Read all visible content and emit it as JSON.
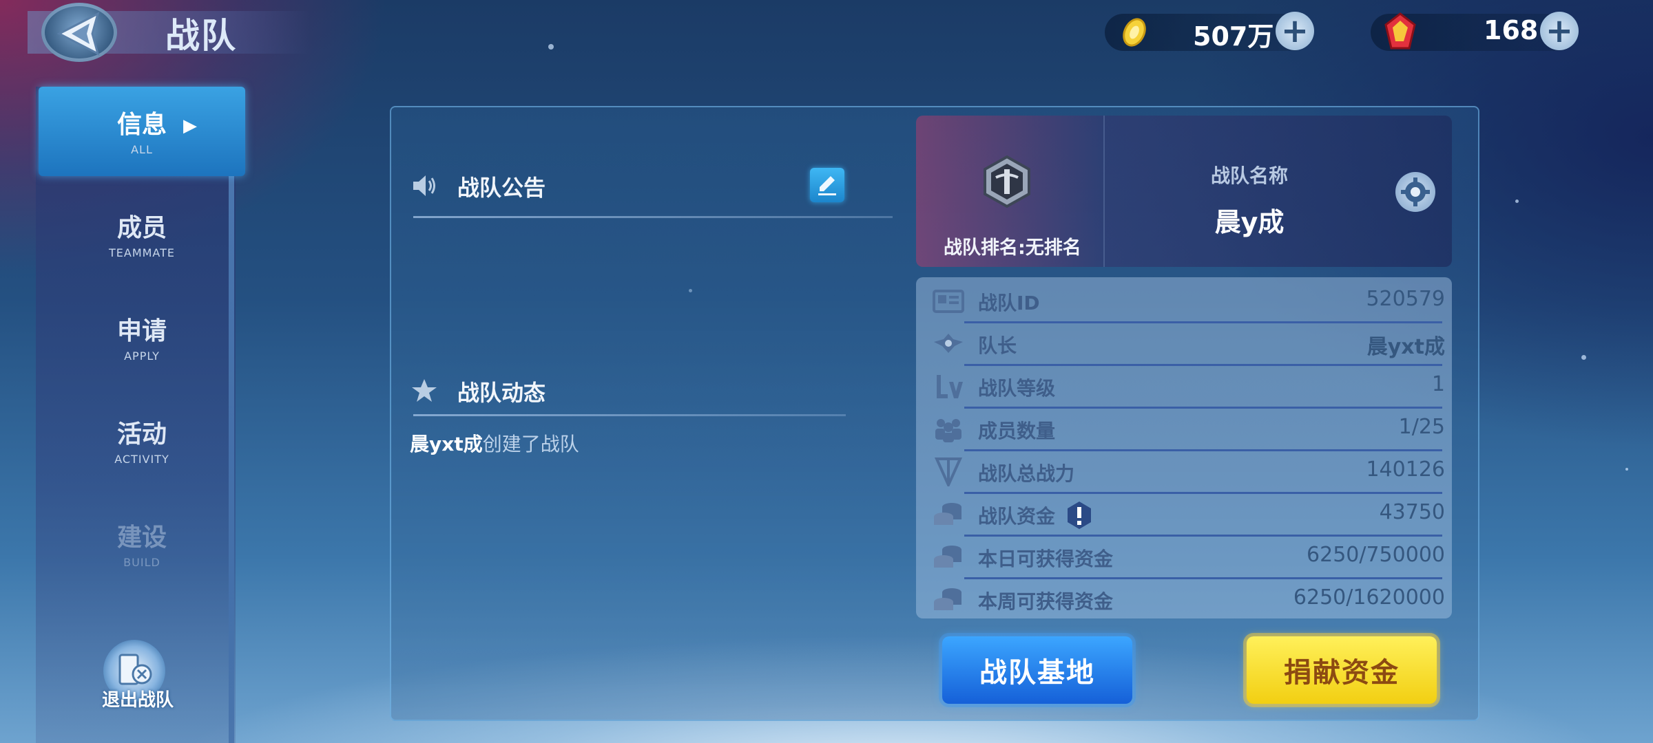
{
  "header": {
    "title": "战队",
    "gold": {
      "value": "507万",
      "icon": "gold-coin-icon"
    },
    "gems": {
      "value": "168",
      "icon": "red-gem-icon"
    }
  },
  "sidebar": {
    "items": [
      {
        "zh": "信息",
        "en": "ALL",
        "state": "active"
      },
      {
        "zh": "成员",
        "en": "TEAMMATE",
        "state": "normal"
      },
      {
        "zh": "申请",
        "en": "APPLY",
        "state": "normal"
      },
      {
        "zh": "活动",
        "en": "ACTIVITY",
        "state": "normal"
      },
      {
        "zh": "建设",
        "en": "BUILD",
        "state": "disabled"
      }
    ],
    "exit_label": "退出战队"
  },
  "announcement": {
    "title": "战队公告"
  },
  "activity": {
    "title": "战队动态",
    "entries": [
      {
        "actor": "晨yxt成",
        "action": "创建了战队"
      }
    ]
  },
  "team": {
    "rank_label": "战队排名",
    "rank_value": "无排名",
    "name_label": "战队名称",
    "name": "晨y成"
  },
  "stats": [
    {
      "label": "战队ID",
      "value": "520579",
      "icon": "id-card-icon"
    },
    {
      "label": "队长",
      "value": "晨yxt成",
      "icon": "captain-wings-icon"
    },
    {
      "label": "战队等级",
      "value": "1",
      "icon": "level-lv-icon"
    },
    {
      "label": "成员数量",
      "value": "1/25",
      "icon": "members-icon"
    },
    {
      "label": "战队总战力",
      "value": "140126",
      "icon": "power-sword-icon"
    },
    {
      "label": "战队资金",
      "value": "43750",
      "icon": "coins-stack-icon"
    },
    {
      "label": "本日可获得资金",
      "value": "6250/750000",
      "icon": "coins-stack-icon"
    },
    {
      "label": "本周可获得资金",
      "value": "6250/1620000",
      "icon": "coins-stack-icon"
    }
  ],
  "buttons": {
    "base": "战队基地",
    "donate": "捐献资金"
  },
  "colors": {
    "accent_blue": "#1d74be",
    "donate_yellow": "#f2cf12",
    "stat_text": "#3f5e8a"
  }
}
